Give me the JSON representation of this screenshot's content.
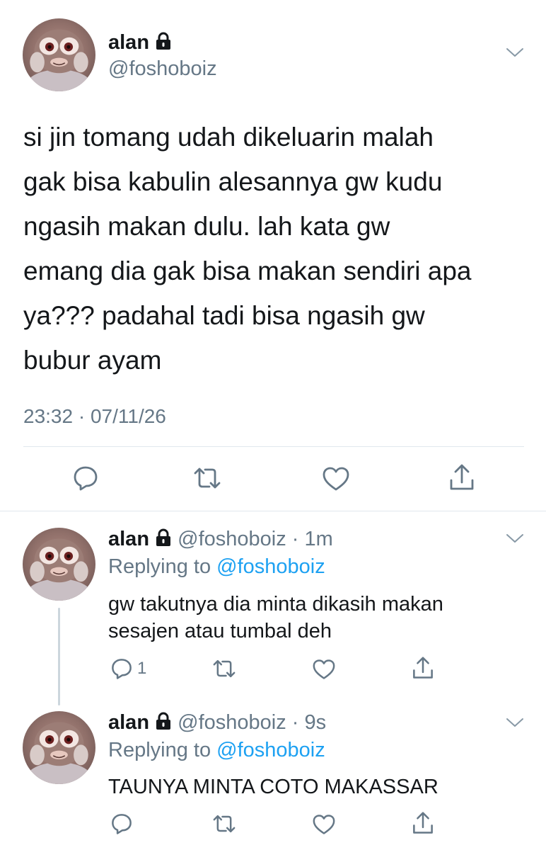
{
  "main_tweet": {
    "name": "alan",
    "handle": "@foshoboiz",
    "text_lines": [
      "si jin tomang udah dikeluarin malah",
      "gak bisa kabulin alesannya gw kudu",
      "ngasih makan dulu. lah kata gw",
      "emang dia gak bisa makan sendiri apa",
      "ya??? padahal tadi bisa ngasih gw",
      "bubur ayam"
    ],
    "timestamp": "23:32 · 07/11/26"
  },
  "replies": [
    {
      "name": "alan",
      "handle_time": "@foshoboiz · 1m",
      "replying_prefix": "Replying to",
      "replying_handle": "@foshoboiz",
      "text_lines": [
        "gw takutnya dia minta dikasih makan",
        "sesajen atau tumbal deh"
      ],
      "reply_count": "1"
    },
    {
      "name": "alan",
      "handle_time": "@foshoboiz · 9s",
      "replying_prefix": "Replying to",
      "replying_handle": "@foshoboiz",
      "text_lines": [
        "TAUNYA MINTA COTO MAKASSAR"
      ],
      "reply_count": ""
    }
  ],
  "icons": {
    "lock": "lock-icon",
    "chevron": "chevron-down-icon",
    "reply": "reply-icon",
    "retweet": "retweet-icon",
    "like": "heart-icon",
    "share": "share-icon"
  },
  "colors": {
    "text": "#14171a",
    "secondary": "#657786",
    "link": "#1da1f2",
    "divider": "#e1e8ed"
  }
}
